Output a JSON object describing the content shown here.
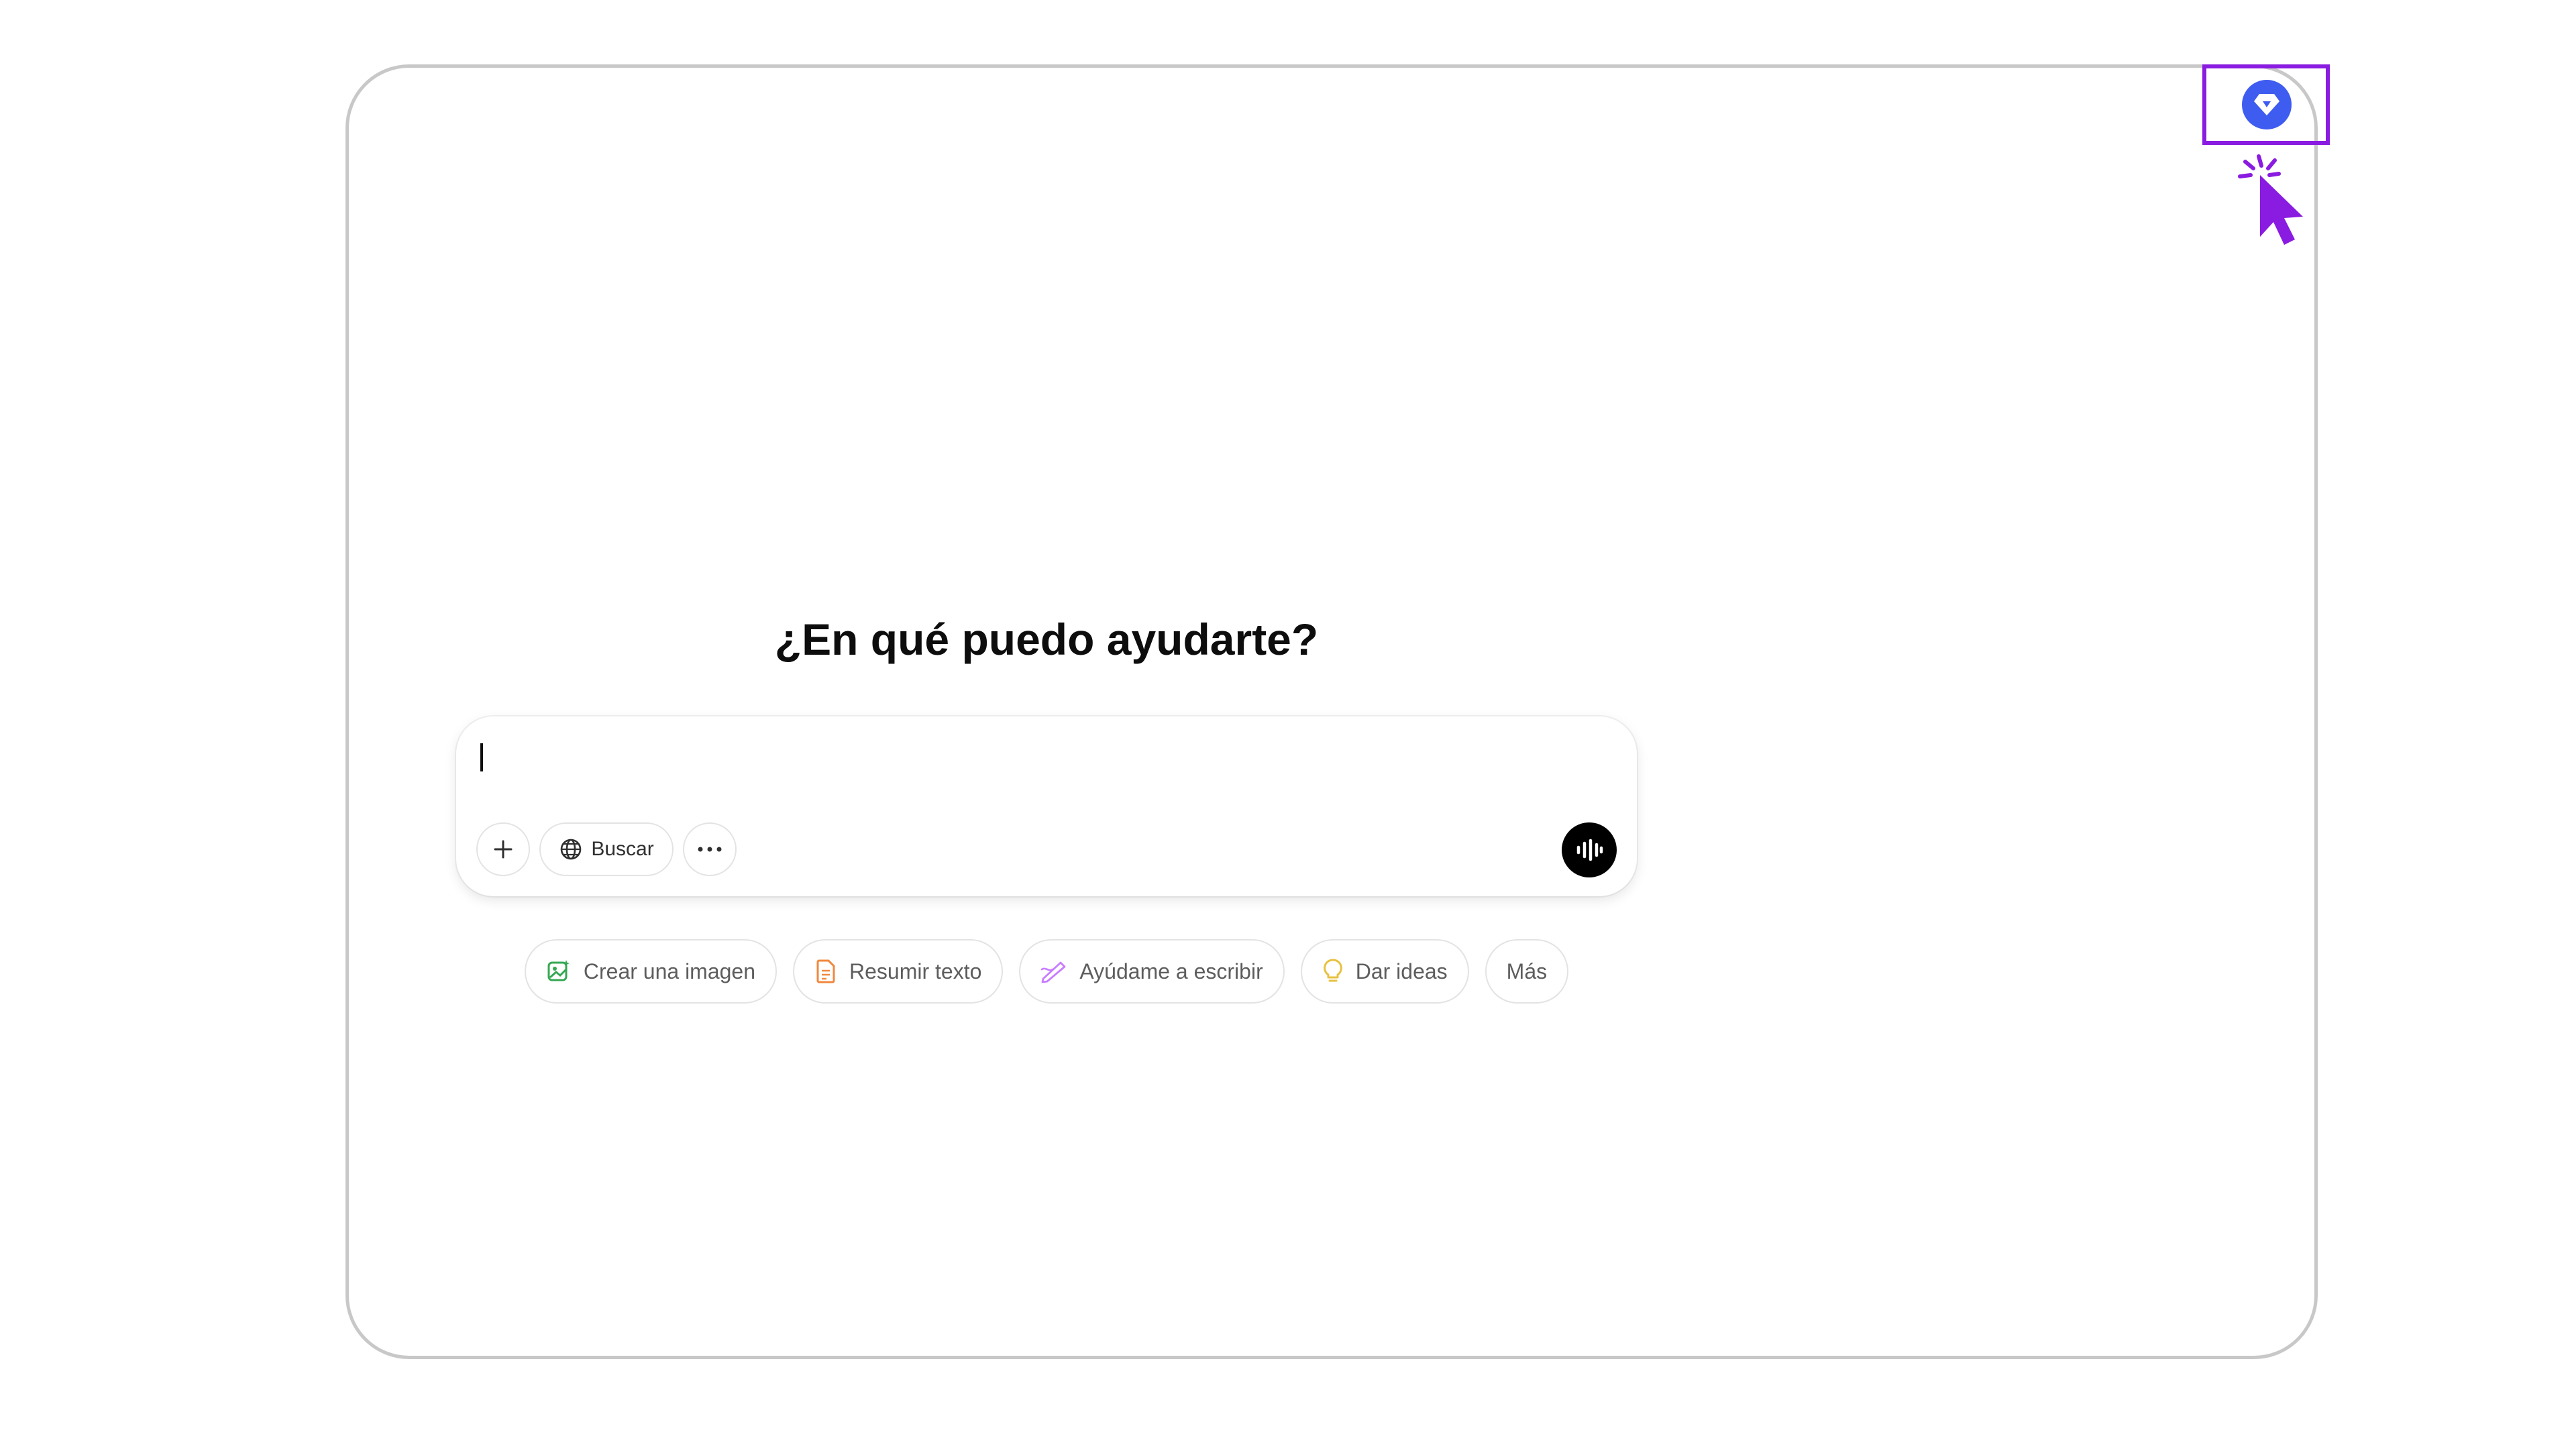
{
  "main": {
    "headline": "¿En qué puedo ayudarte?"
  },
  "composer": {
    "input_value": "",
    "search_label": "Buscar",
    "icons": [
      "plus-icon",
      "globe-icon",
      "ellipsis-icon",
      "voice-wave-icon"
    ]
  },
  "suggestions": [
    {
      "label": "Crear una imagen",
      "icon": "image-icon",
      "color": "#34a853"
    },
    {
      "label": "Resumir texto",
      "icon": "document-icon",
      "color": "#f0883e"
    },
    {
      "label": "Ayúdame a escribir",
      "icon": "pen-icon",
      "color": "#c77dff"
    },
    {
      "label": "Dar ideas",
      "icon": "lightbulb-icon",
      "color": "#e8c140"
    },
    {
      "label": "Más",
      "icon": "",
      "color": ""
    }
  ],
  "colors": {
    "gem_button": "#3f5cf0",
    "highlight": "#8a1be0",
    "frame_border": "#c8c8c8",
    "voice_button": "#000000"
  }
}
